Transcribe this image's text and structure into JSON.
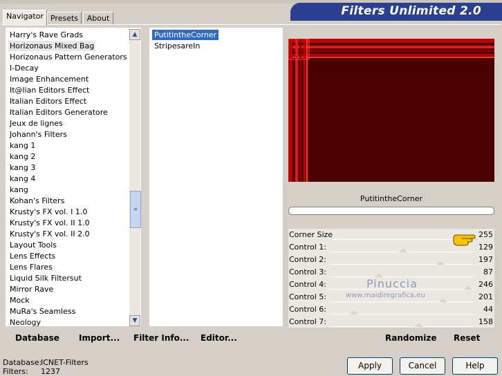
{
  "window": {
    "title": "Filters Unlimited 2.0"
  },
  "tabs": [
    {
      "label": "Navigator",
      "active": true
    },
    {
      "label": "Presets",
      "active": false
    },
    {
      "label": "About",
      "active": false
    }
  ],
  "filter_list": {
    "items": [
      "Harry's Rave Grads",
      "Horizonaus Mixed Bag",
      "Horizonaus Pattern Generators",
      "I-Decay",
      "Image Enhancement",
      "It@lian Editors Effect",
      "Italian Editors Effect",
      "Italian Editors Generatore",
      "Jeux de lignes",
      "Johann's Filters",
      "kang 1",
      "kang 2",
      "kang 3",
      "kang 4",
      "kang",
      "Kohan's Filters",
      "Krusty's FX vol. I 1.0",
      "Krusty's FX vol. II 1.0",
      "Krusty's FX vol. II 2.0",
      "Layout Tools",
      "Lens Effects",
      "Lens Flares",
      "Liquid Silk Filtersut",
      "Mirror Rave",
      "Mock",
      "MuRa's Seamless",
      "Neology"
    ],
    "selected": "Horizonaus Mixed Bag"
  },
  "subfilter_list": {
    "items": [
      "PutitintheCorner",
      "StripesareIn"
    ],
    "selected": "PutitintheCorner"
  },
  "preview": {
    "filter_name": "PutitintheCorner",
    "colors": {
      "bg": "#4a0000",
      "stripe": "#c00000",
      "highlight": "#ff3030"
    }
  },
  "controls": [
    {
      "label": "Corner Size",
      "value": "255",
      "level": 1.0
    },
    {
      "label": "Control 1:",
      "value": "129",
      "level": 0.51
    },
    {
      "label": "Control 2:",
      "value": "197",
      "level": 0.77
    },
    {
      "label": "Control 3:",
      "value": "87",
      "level": 0.34
    },
    {
      "label": "Control 4:",
      "value": "246",
      "level": 0.96
    },
    {
      "label": "Control 5:",
      "value": "201",
      "level": 0.79
    },
    {
      "label": "Control 6:",
      "value": "44",
      "level": 0.17
    },
    {
      "label": "Control 7:",
      "value": "158",
      "level": 0.62
    }
  ],
  "watermark": {
    "line1": "Pinuccia",
    "line2": "www.maidiregrafica.eu"
  },
  "toolbar": {
    "database_label": "Database",
    "import_label": "Import...",
    "filter_info_label": "Filter Info...",
    "editor_label": "Editor...",
    "randomize_label": "Randomize",
    "reset_label": "Reset"
  },
  "status": {
    "database_label": "Database:",
    "database_value": "ICNET-Filters",
    "filters_label": "Filters:",
    "filters_value": "1237"
  },
  "buttons": {
    "apply": "Apply",
    "cancel": "Cancel",
    "help": "Help"
  }
}
